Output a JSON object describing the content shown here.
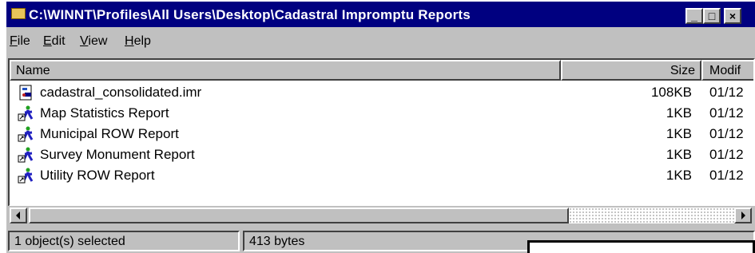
{
  "window": {
    "title": "C:\\WINNT\\Profiles\\All Users\\Desktop\\Cadastral Impromptu Reports",
    "title_buttons": {
      "minimize": "_",
      "maximize": "□",
      "close": "×"
    }
  },
  "menu": [
    {
      "mnemonic": "F",
      "rest": "ile"
    },
    {
      "mnemonic": "E",
      "rest": "dit"
    },
    {
      "mnemonic": "V",
      "rest": "iew"
    },
    {
      "mnemonic": "H",
      "rest": "elp"
    }
  ],
  "columns": {
    "name": "Name",
    "size": "Size",
    "modified": "Modif"
  },
  "files": [
    {
      "name": "cadastral_consolidated.imr",
      "size": "108KB",
      "modified": "01/12",
      "icon": "catalog-file-icon"
    },
    {
      "name": "Map Statistics Report",
      "size": "1KB",
      "modified": "01/12",
      "icon": "report-shortcut-icon"
    },
    {
      "name": "Municipal ROW Report",
      "size": "1KB",
      "modified": "01/12",
      "icon": "report-shortcut-icon"
    },
    {
      "name": "Survey Monument Report",
      "size": "1KB",
      "modified": "01/12",
      "icon": "report-shortcut-icon"
    },
    {
      "name": "Utility ROW Report",
      "size": "1KB",
      "modified": "01/12",
      "icon": "report-shortcut-icon"
    }
  ],
  "status": {
    "selection": "1 object(s) selected",
    "bytes": "413 bytes"
  },
  "colors": {
    "title_bg": "#000080",
    "face": "#c0c0c0",
    "window_bg": "#ffffff"
  }
}
